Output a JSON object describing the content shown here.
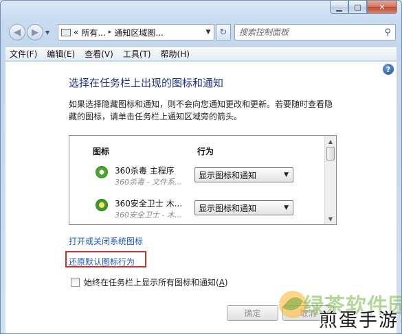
{
  "window": {
    "caption_buttons": [
      "minimize",
      "maximize",
      "close"
    ]
  },
  "nav": {
    "back_icon": "back-arrow-icon",
    "forward_icon": "forward-arrow-icon"
  },
  "address": {
    "prefix": "«",
    "crumbs": [
      "所有...",
      "通知区域图..."
    ],
    "separator": "▸"
  },
  "search": {
    "placeholder": "搜索控制面板"
  },
  "menu": [
    "文件(F)",
    "编辑(E)",
    "查看(V)",
    "工具(T)",
    "帮助(H)"
  ],
  "main": {
    "heading": "选择在任务栏上出现的图标和通知",
    "description": "如果选择隐藏图标和通知，则不会向您通知更改和更新。若要随时查看隐藏的图标，请单击任务栏上通知区域旁的箭头。",
    "table": {
      "headers": {
        "icons": "图标",
        "behavior": "行为"
      },
      "rows": [
        {
          "name": "360杀毒 主程序",
          "sub": "360杀毒 - 文件系...",
          "behavior": "显示图标和通知",
          "icon": "360-antivirus-icon"
        },
        {
          "name": "360安全卫士 木...",
          "sub": "360安全卫士 - 木...",
          "behavior": "显示图标和通知",
          "icon": "360-safeguard-icon"
        }
      ]
    },
    "link_turn_system_icons": "打开或关闭系统图标",
    "link_restore_defaults": "还原默认图标行为",
    "checkbox_always_show": {
      "label": "始终在任务栏上显示所有图标和通知(",
      "mnemonic": "A",
      "suffix": ")",
      "checked": false
    },
    "ok_label": "确定",
    "cancel_label": "取消"
  },
  "watermark": {
    "site": "绿茶软件园",
    "brand": "煎蛋手游"
  },
  "colors": {
    "heading": "#1e3287",
    "link": "#1d56b6",
    "highlight_box": "#d22d2d"
  }
}
